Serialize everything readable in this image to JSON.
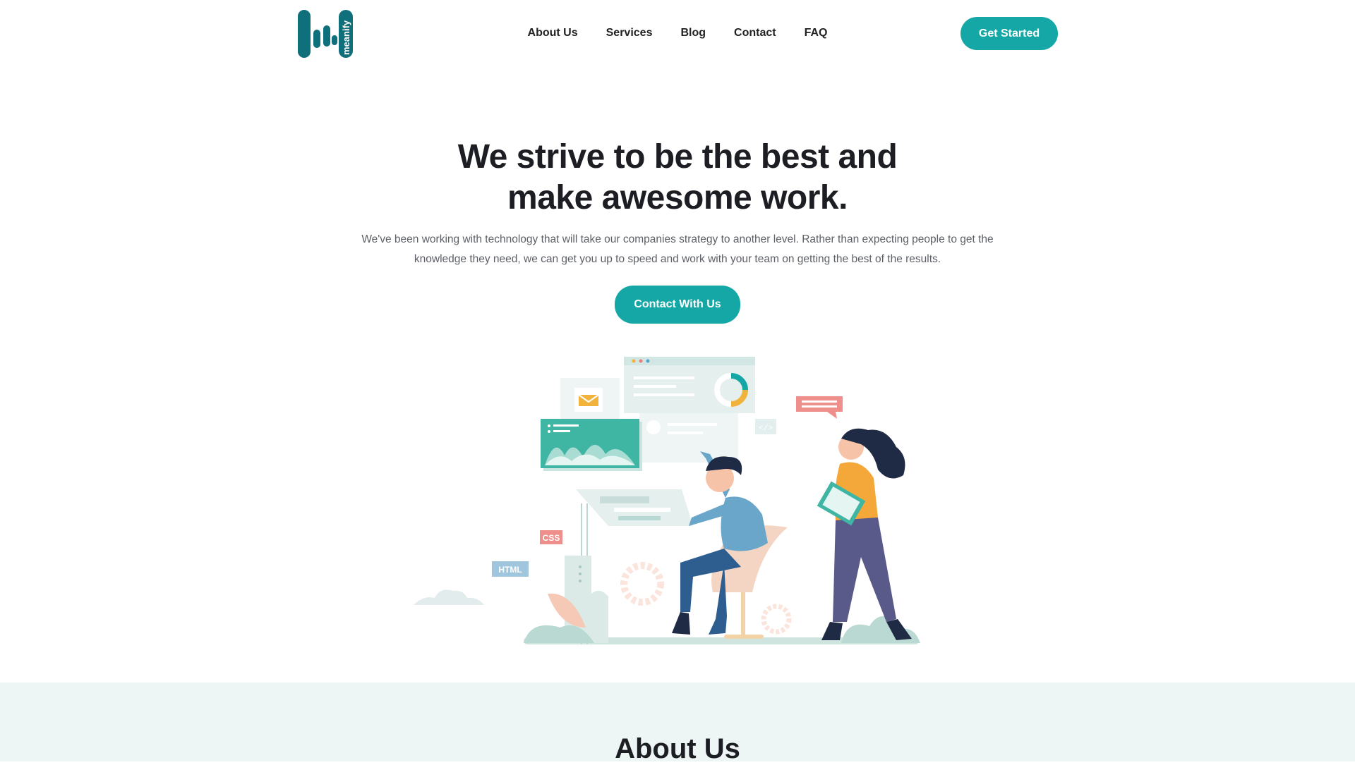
{
  "brand": {
    "logo_text": "meanify",
    "accent_color": "#14a7a6",
    "logo_color": "#0f6f7a"
  },
  "nav": {
    "links": [
      "About Us",
      "Services",
      "Blog",
      "Contact",
      "FAQ"
    ],
    "cta_label": "Get Started"
  },
  "hero": {
    "title_line1": "We strive to be the best and",
    "title_line2": "make awesome work.",
    "description": "We've been working with technology that will take our companies strategy to another level. Rather than expecting people to get the knowledge they need, we can get you up to speed and work with your team on getting the best of the results.",
    "cta_label": "Contact With Us"
  },
  "illustration": {
    "tag_css": "CSS",
    "tag_html": "HTML",
    "tag_code": "</>"
  },
  "about": {
    "title": "About Us",
    "background": "#eef5f5"
  }
}
